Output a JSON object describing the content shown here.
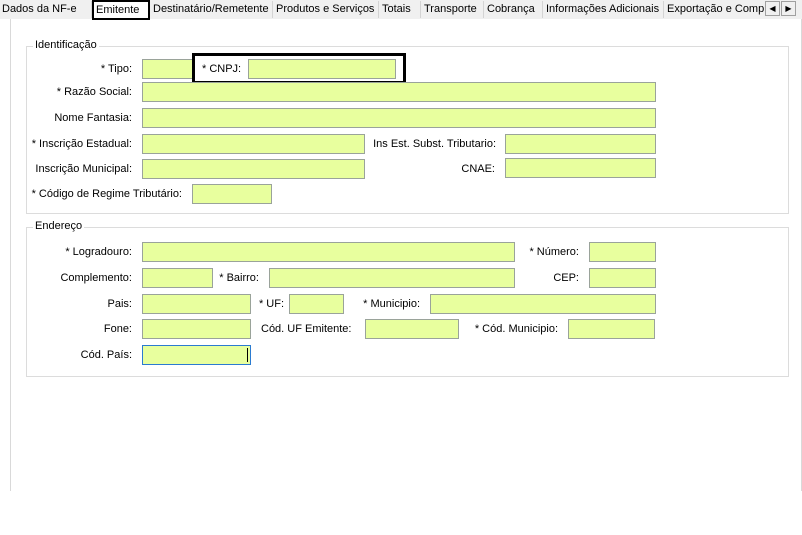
{
  "tabs": [
    {
      "label": "Dados da NF-e",
      "active": false
    },
    {
      "label": "Emitente",
      "active": true
    },
    {
      "label": "Destinatário/Remetente",
      "active": false
    },
    {
      "label": "Produtos e Serviços",
      "active": false
    },
    {
      "label": "Totais",
      "active": false
    },
    {
      "label": "Transporte",
      "active": false
    },
    {
      "label": "Cobrança",
      "active": false
    },
    {
      "label": "Informações Adicionais",
      "active": false
    },
    {
      "label": "Exportação e Compras",
      "active": false
    }
  ],
  "scroll": {
    "left": "◀",
    "right": "▶"
  },
  "identificacao": {
    "legend": "Identificação",
    "tipo_label": "* Tipo:",
    "tipo_value": "",
    "cnpj_label": "* CNPJ:",
    "cnpj_value": "",
    "razao_social_label": "* Razão Social:",
    "razao_social_value": "",
    "nome_fantasia_label": "Nome Fantasia:",
    "nome_fantasia_value": "",
    "ie_label": "* Inscrição Estadual:",
    "ie_value": "",
    "ie_st_label": "Ins Est. Subst. Tributario:",
    "ie_st_value": "",
    "im_label": "Inscrição Municipal:",
    "im_value": "",
    "cnae_label": "CNAE:",
    "cnae_value": "",
    "crt_label": "* Código de Regime Tributário:",
    "crt_value": ""
  },
  "endereco": {
    "legend": "Endereço",
    "logradouro_label": "* Logradouro:",
    "logradouro_value": "",
    "numero_label": "* Número:",
    "numero_value": "",
    "complemento_label": "Complemento:",
    "complemento_value": "",
    "bairro_label": "* Bairro:",
    "bairro_value": "",
    "cep_label": "CEP:",
    "cep_value": "",
    "pais_label": "Pais:",
    "pais_value": "",
    "uf_label": "* UF:",
    "uf_value": "",
    "municipio_label": "* Municipio:",
    "municipio_value": "",
    "fone_label": "Fone:",
    "fone_value": "",
    "cod_uf_label": "Cód. UF Emitente:",
    "cod_uf_value": "",
    "cod_municipio_label": "* Cód. Municipio:",
    "cod_municipio_value": "",
    "cod_pais_label": "Cód. País:",
    "cod_pais_value": ""
  },
  "colors": {
    "field_bg": "#e8ff9e",
    "focus_border": "#2b7bd1"
  }
}
